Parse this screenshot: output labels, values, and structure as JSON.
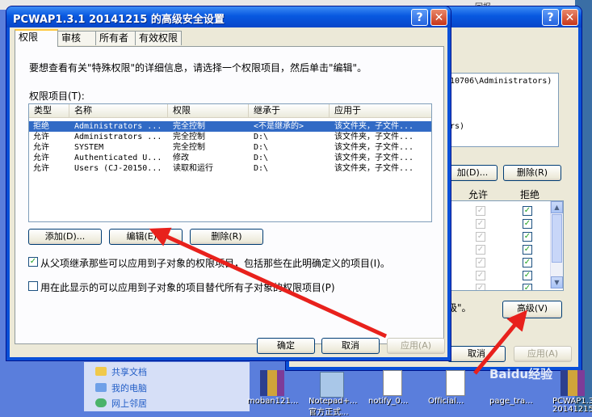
{
  "desktop": {
    "tray_text": "回报",
    "icons": [
      {
        "label": "moban121..."
      },
      {
        "label": "Notepad+..."
      },
      {
        "label": "notify_0..."
      },
      {
        "label": "Official..."
      },
      {
        "label": "page_tra..."
      },
      {
        "label": "PCWAP1.3"
      },
      {
        "label": "20141215"
      }
    ],
    "sub_label": "官方正式..."
  },
  "explorer": {
    "items": [
      {
        "label": "共享文档"
      },
      {
        "label": "我的电脑"
      },
      {
        "label": "网上邻居"
      }
    ]
  },
  "background_window": {
    "path_text": "10706\\Administrators)",
    "users_text": "rs)",
    "add_button": "加(D)...",
    "remove_button": "删除(R)",
    "col_allow": "允许",
    "col_deny": "拒绝",
    "note_text": "级\"。",
    "advanced_button": "高级(V)",
    "cancel_button": "取消",
    "apply_button": "应用(A)",
    "allow_checks": [
      true,
      true,
      true,
      true,
      true,
      true,
      true
    ],
    "deny_checks": [
      true,
      true,
      true,
      true,
      true,
      true,
      true
    ]
  },
  "dialog": {
    "title": "PCWAP1.3.1 20141215 的高级安全设置",
    "tabs": [
      {
        "label": "权限"
      },
      {
        "label": "审核"
      },
      {
        "label": "所有者"
      },
      {
        "label": "有效权限"
      }
    ],
    "instruction": "要想查看有关\"特殊权限\"的详细信息，请选择一个权限项目，然后单击\"编辑\"。",
    "entries_label": "权限项目(T):",
    "columns": [
      "类型",
      "名称",
      "权限",
      "继承于",
      "应用于"
    ],
    "rows": [
      {
        "type": "拒绝",
        "name": "Administrators ...",
        "perm": "完全控制",
        "inherit": "<不是继承的>",
        "apply": "该文件夹，子文件..."
      },
      {
        "type": "允许",
        "name": "Administrators ...",
        "perm": "完全控制",
        "inherit": "D:\\",
        "apply": "该文件夹，子文件..."
      },
      {
        "type": "允许",
        "name": "SYSTEM",
        "perm": "完全控制",
        "inherit": "D:\\",
        "apply": "该文件夹，子文件..."
      },
      {
        "type": "允许",
        "name": "Authenticated U...",
        "perm": "修改",
        "inherit": "D:\\",
        "apply": "该文件夹，子文件..."
      },
      {
        "type": "允许",
        "name": "Users (CJ-20150...",
        "perm": "读取和运行",
        "inherit": "D:\\",
        "apply": "该文件夹，子文件..."
      }
    ],
    "add_button": "添加(D)...",
    "edit_button": "编辑(E)...",
    "remove_button": "删除(R)",
    "inherit_checkbox": "从父项继承那些可以应用到子对象的权限项目，包括那些在此明确定义的项目(I)。",
    "inherit_checked": true,
    "replace_checkbox": "用在此显示的可以应用到子对象的项目替代所有子对象的权限项目(P)",
    "replace_checked": false,
    "ok_button": "确定",
    "cancel_button": "取消",
    "apply_button": "应用(A)"
  },
  "watermark": "Baidu经验",
  "colors": {
    "annotation_arrow": "#e8211c",
    "selection": "#316ac5"
  }
}
